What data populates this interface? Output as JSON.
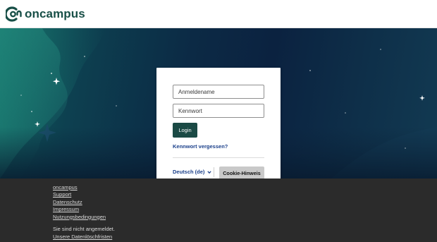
{
  "header": {
    "logo_text": "oncampus",
    "brand_color": "#184f47"
  },
  "login_form": {
    "username_placeholder": "Anmeldename",
    "password_placeholder": "Kennwort",
    "login_label": "Login",
    "forgot_label": "Kennwort vergessen?",
    "language_label": "Deutsch (de)",
    "cookie_label": "Cookie-Hinweis",
    "accent_color": "#1b4a45",
    "link_color": "#1a3f8a"
  },
  "footer": {
    "links": [
      "oncampus",
      "Support",
      "Datenschutz",
      "Impressum",
      "Nutzungsbedingungen"
    ],
    "status_text": "Sie sind nicht angemeldet.",
    "data_retention_label": "Unsere Datenlöschfristen",
    "background_color": "#2b2b2b"
  }
}
